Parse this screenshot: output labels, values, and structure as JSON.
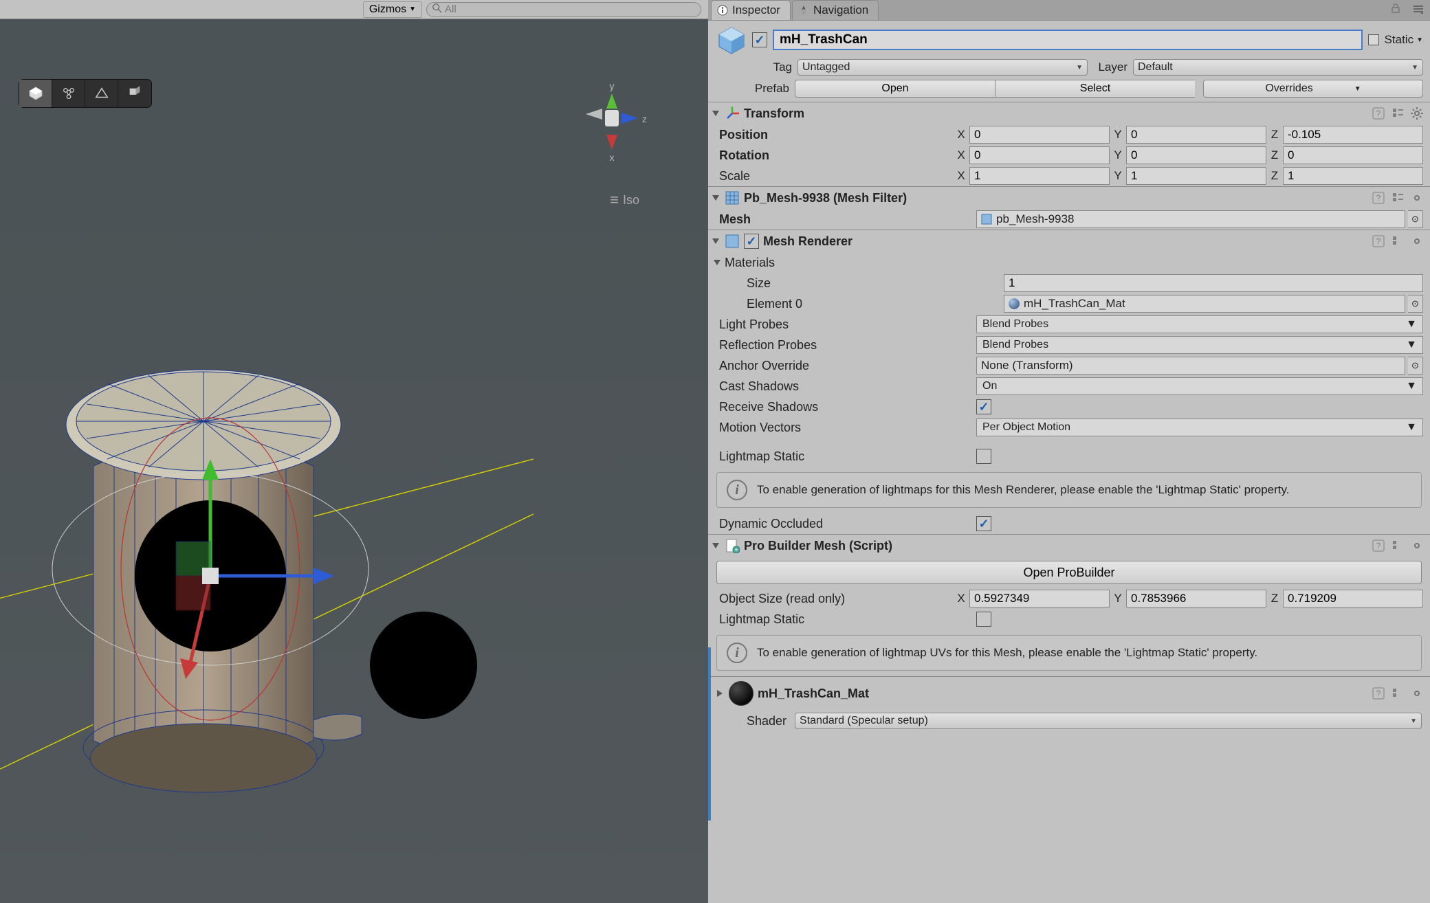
{
  "scene": {
    "gizmos_label": "Gizmos",
    "search_placeholder": "All",
    "iso_label": "Iso",
    "axis": {
      "x": "x",
      "y": "y",
      "z": "z"
    }
  },
  "tabs": {
    "inspector": "Inspector",
    "navigation": "Navigation"
  },
  "header": {
    "enabled": true,
    "name": "mH_TrashCan",
    "static_label": "Static",
    "tag_label": "Tag",
    "tag_value": "Untagged",
    "layer_label": "Layer",
    "layer_value": "Default",
    "prefab_label": "Prefab",
    "open_btn": "Open",
    "select_btn": "Select",
    "overrides_btn": "Overrides"
  },
  "transform": {
    "title": "Transform",
    "position_label": "Position",
    "rotation_label": "Rotation",
    "scale_label": "Scale",
    "position": {
      "x": "0",
      "y": "0",
      "z": "-0.105"
    },
    "rotation": {
      "x": "0",
      "y": "0",
      "z": "0"
    },
    "scale": {
      "x": "1",
      "y": "1",
      "z": "1"
    }
  },
  "meshFilter": {
    "title": "Pb_Mesh-9938 (Mesh Filter)",
    "mesh_label": "Mesh",
    "mesh_value": "pb_Mesh-9938"
  },
  "meshRenderer": {
    "title": "Mesh Renderer",
    "enabled": true,
    "materials_foldout_label": "Materials",
    "size_label": "Size",
    "size_value": "1",
    "element0_label": "Element 0",
    "element0_value": "mH_TrashCan_Mat",
    "light_probes_label": "Light Probes",
    "light_probes_value": "Blend Probes",
    "reflection_probes_label": "Reflection Probes",
    "reflection_probes_value": "Blend Probes",
    "anchor_override_label": "Anchor Override",
    "anchor_override_value": "None (Transform)",
    "cast_shadows_label": "Cast Shadows",
    "cast_shadows_value": "On",
    "receive_shadows_label": "Receive Shadows",
    "receive_shadows_checked": true,
    "motion_vectors_label": "Motion Vectors",
    "motion_vectors_value": "Per Object Motion",
    "lightmap_static_label": "Lightmap Static",
    "lightmap_static_checked": false,
    "info_text": "To enable generation of lightmaps for this Mesh Renderer, please enable the 'Lightmap Static' property.",
    "dynamic_occluded_label": "Dynamic Occluded",
    "dynamic_occluded_checked": true
  },
  "proBuilder": {
    "title": "Pro Builder Mesh (Script)",
    "open_btn": "Open ProBuilder",
    "object_size_label": "Object Size (read only)",
    "object_size": {
      "x": "0.5927349",
      "y": "0.7853966",
      "z": "0.719209"
    },
    "lightmap_static_label": "Lightmap Static",
    "lightmap_static_checked": false,
    "info_text": "To enable generation of lightmap UVs for this Mesh, please enable the 'Lightmap Static' property."
  },
  "material": {
    "name": "mH_TrashCan_Mat",
    "shader_label": "Shader",
    "shader_value": "Standard (Specular setup)"
  },
  "axis_letters": {
    "x": "X",
    "y": "Y",
    "z": "Z"
  }
}
